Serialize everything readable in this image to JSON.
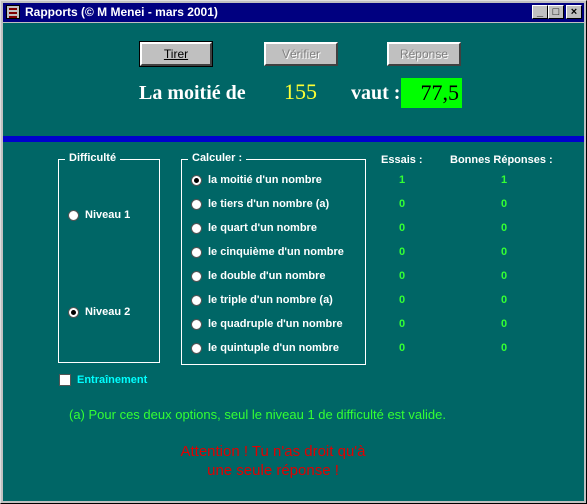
{
  "window": {
    "title": "Rapports (© M Menei - mars 2001)",
    "controls": [
      "_",
      "□",
      "×"
    ]
  },
  "buttons": {
    "tirer": "Tirer",
    "verifier": "Vérifier",
    "reponse": "Réponse"
  },
  "question": {
    "prefix": "La moitié de",
    "number": "155",
    "vaut": "vaut :",
    "answer": "77,5"
  },
  "difficulty": {
    "title": "Difficulté",
    "levels": [
      "Niveau 1",
      "Niveau 2"
    ],
    "selected_index": 1
  },
  "calculer": {
    "title": "Calculer :",
    "options": [
      "la moitié d'un nombre",
      "le tiers d'un nombre (a)",
      "le quart d'un nombre",
      "le cinquième d'un nombre",
      "le double d'un nombre",
      "le triple d'un nombre (a)",
      "le quadruple d'un nombre",
      "le quintuple d'un nombre"
    ],
    "selected_index": 0
  },
  "stats": {
    "essais_header": "Essais :",
    "bonnes_header": "Bonnes Réponses :",
    "essais": [
      "1",
      "0",
      "0",
      "0",
      "0",
      "0",
      "0",
      "0"
    ],
    "bonnes": [
      "1",
      "0",
      "0",
      "0",
      "0",
      "0",
      "0",
      "0"
    ]
  },
  "training": {
    "label": "Entraînement",
    "checked": false
  },
  "note": "(a) Pour ces deux options, seul le niveau 1 de difficulté est valide.",
  "warning": {
    "line1": "Attention ! Tu n'as droit qu'à",
    "line2": "une seule réponse !"
  },
  "colors": {
    "background": "#006666",
    "divider": "#0000cc",
    "number": "#ffff33",
    "answer_bg": "#00ff00",
    "counts": "#33ff33",
    "training": "#00ffff",
    "warning": "#e00000"
  }
}
